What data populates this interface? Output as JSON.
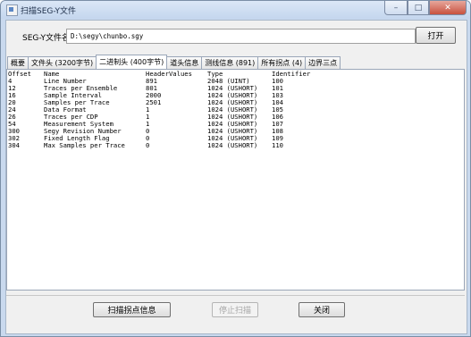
{
  "window": {
    "title": "扫描SEG-Y文件",
    "buttons": {
      "minimize": "–",
      "maximize": "□",
      "close": "✕"
    }
  },
  "file": {
    "label": "SEG-Y文件名:",
    "value": "D:\\segy\\chunbo.sgy",
    "open_button": "打开"
  },
  "tabs": [
    {
      "label": "概要"
    },
    {
      "label": "文件头 (3200字节)"
    },
    {
      "label": "二进制头 (400字节)",
      "active": true
    },
    {
      "label": "道头信息"
    },
    {
      "label": "测线信息 (891)"
    },
    {
      "label": "所有拐点 (4)"
    },
    {
      "label": "边界三点"
    }
  ],
  "table": {
    "headers": [
      "Offset",
      "Name",
      "HeaderValues",
      "Type",
      "Identifier"
    ],
    "rows": [
      [
        "4",
        "Line Number",
        "891",
        "2048 (UINT)",
        "100"
      ],
      [
        "12",
        "Traces per Ensemble",
        "801",
        "1024 (USHORT)",
        "101"
      ],
      [
        "16",
        "Sample Interval",
        "2000",
        "1024 (USHORT)",
        "103"
      ],
      [
        "20",
        "Samples per Trace",
        "2501",
        "1024 (USHORT)",
        "104"
      ],
      [
        "24",
        "Data Format",
        "1",
        "1024 (USHORT)",
        "105"
      ],
      [
        "26",
        "Traces per CDP",
        "1",
        "1024 (USHORT)",
        "106"
      ],
      [
        "54",
        "Measurement System",
        "1",
        "1024 (USHORT)",
        "107"
      ],
      [
        "300",
        "Segy Revision Number",
        "0",
        "1024 (USHORT)",
        "108"
      ],
      [
        "302",
        "Fixed Length Flag",
        "0",
        "1024 (USHORT)",
        "109"
      ],
      [
        "304",
        "Max Samples per Trace",
        "0",
        "1024 (USHORT)",
        "110"
      ]
    ]
  },
  "actions": {
    "scan": "扫描拐点信息",
    "stop": "停止扫描",
    "close": "关闭"
  }
}
